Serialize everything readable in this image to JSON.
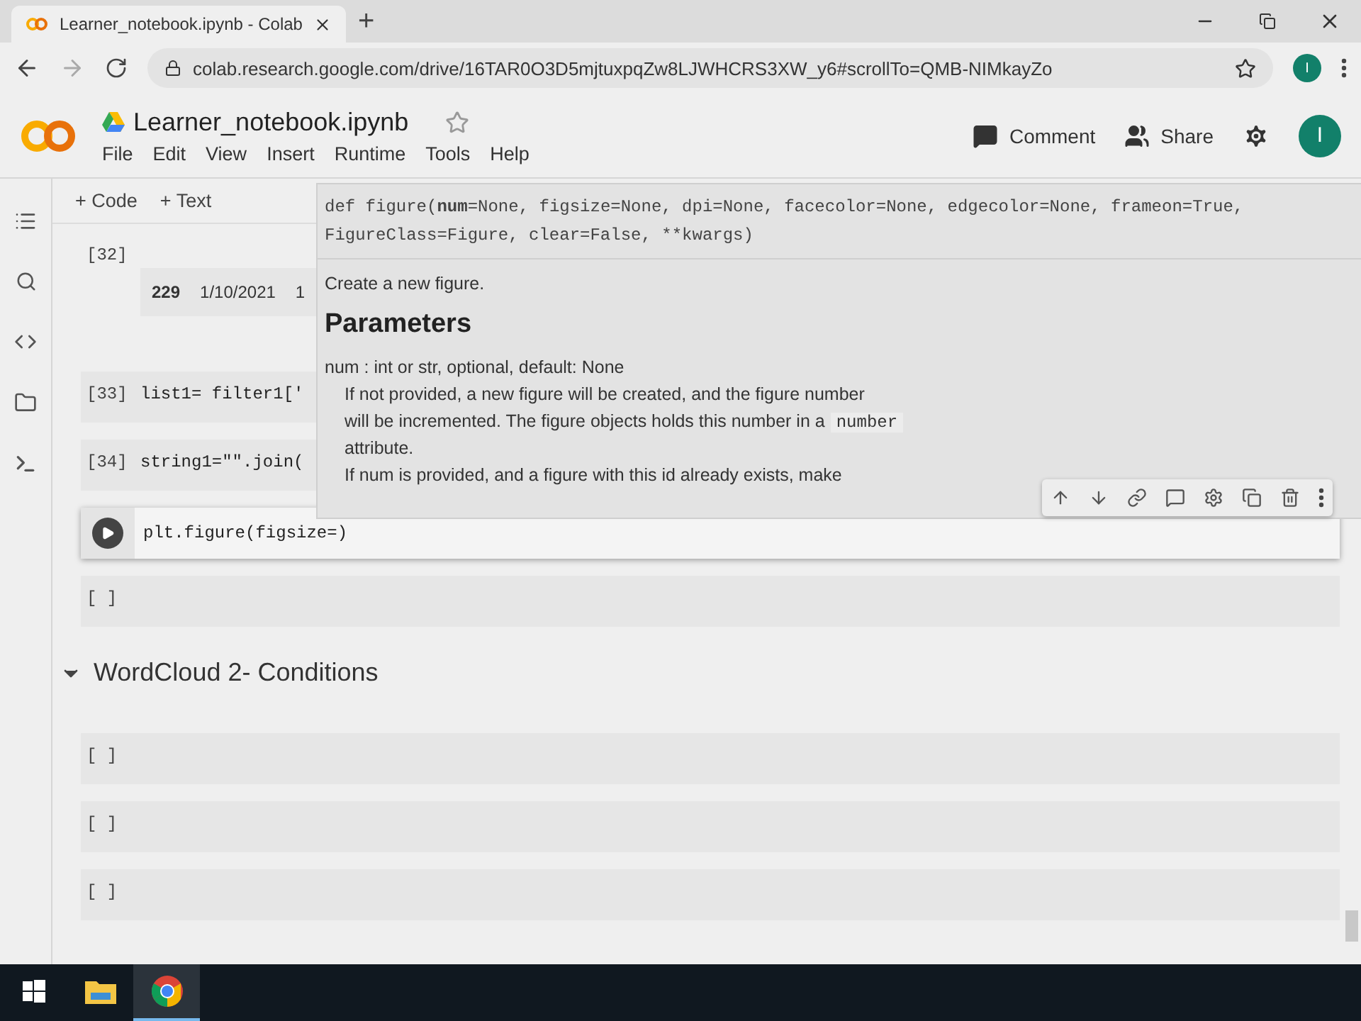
{
  "browser": {
    "tab_title": "Learner_notebook.ipynb - Colab",
    "new_tab": "+",
    "url": "colab.research.google.com/drive/16TAR0O3D5mjtuxpqZw8LJWHCRS3XW_y6#scrollTo=QMB-NIMkayZo",
    "profile": "I"
  },
  "notebook": {
    "title": "Learner_notebook.ipynb",
    "menu": [
      "File",
      "Edit",
      "View",
      "Insert",
      "Runtime",
      "Tools",
      "Help"
    ],
    "actions": [
      "Comment",
      "Share"
    ],
    "avatar": "I"
  },
  "toolbar": [
    "+ Code",
    "+ Text"
  ],
  "cells": [
    {
      "kind": "output",
      "prompt": "[32]",
      "output": [
        "229",
        "1/10/2021",
        "1"
      ]
    },
    {
      "kind": "code",
      "prompt": "[33]",
      "code": "list1= filter1['"
    },
    {
      "kind": "code",
      "prompt": "[34]",
      "code": "string1=\"\".join("
    },
    {
      "kind": "active",
      "code": "plt.figure(figsize=)"
    },
    {
      "kind": "empty",
      "prompt": "[ ]"
    },
    {
      "kind": "section",
      "title": "WordCloud 2- Conditions",
      "expanded": true
    },
    {
      "kind": "empty",
      "prompt": "[ ]"
    },
    {
      "kind": "empty",
      "prompt": "[ ]"
    },
    {
      "kind": "empty",
      "prompt": "[ ]"
    }
  ],
  "tooltip": {
    "signature": "def figure(**num**=None, figsize=None, dpi=None, facecolor=None, edgecolor=None, frameon=True, FigureClass=Figure, clear=False, **kwargs)",
    "description": "Create a new figure.",
    "heading": "Parameters",
    "param": "num : int or str, optional, default: None",
    "lines": [
      "If not provided, a new figure will be created, and the figure number",
      "will be incremented. The figure objects holds this number in a"
    ],
    "inline_code": "number",
    "tail": [
      "attribute.",
      "If num is provided, and a figure with this id already exists, make"
    ]
  },
  "taskbar": [
    {
      "kind": "start",
      "selected": false
    },
    {
      "kind": "folder",
      "selected": false
    },
    {
      "kind": "chrome",
      "selected": true
    }
  ]
}
